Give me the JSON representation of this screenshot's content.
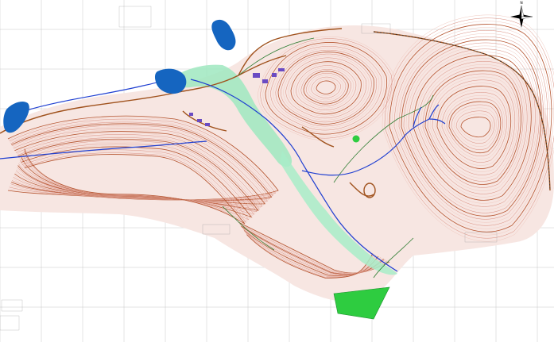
{
  "map": {
    "north_arrow_label": "N",
    "colors": {
      "background": "#ffffff",
      "grid": "#c8c8c8",
      "contour_primary": "#d88b7c",
      "contour_secondary": "#f0c9c0",
      "contour_index": "#b5542f",
      "road": "#a0521d",
      "water": "#1565c0",
      "stream": "#1f3fd1",
      "vegetation": "#8ee3b3",
      "green_zone": "#2ecc40",
      "boundary": "#2e7d32"
    },
    "features": {
      "lakes": [
        "lake-1",
        "lake-2",
        "lake-3"
      ],
      "vegetation_zones": [
        "riparian-strip",
        "stream-corridor"
      ],
      "green_plot": "plot-south"
    }
  }
}
